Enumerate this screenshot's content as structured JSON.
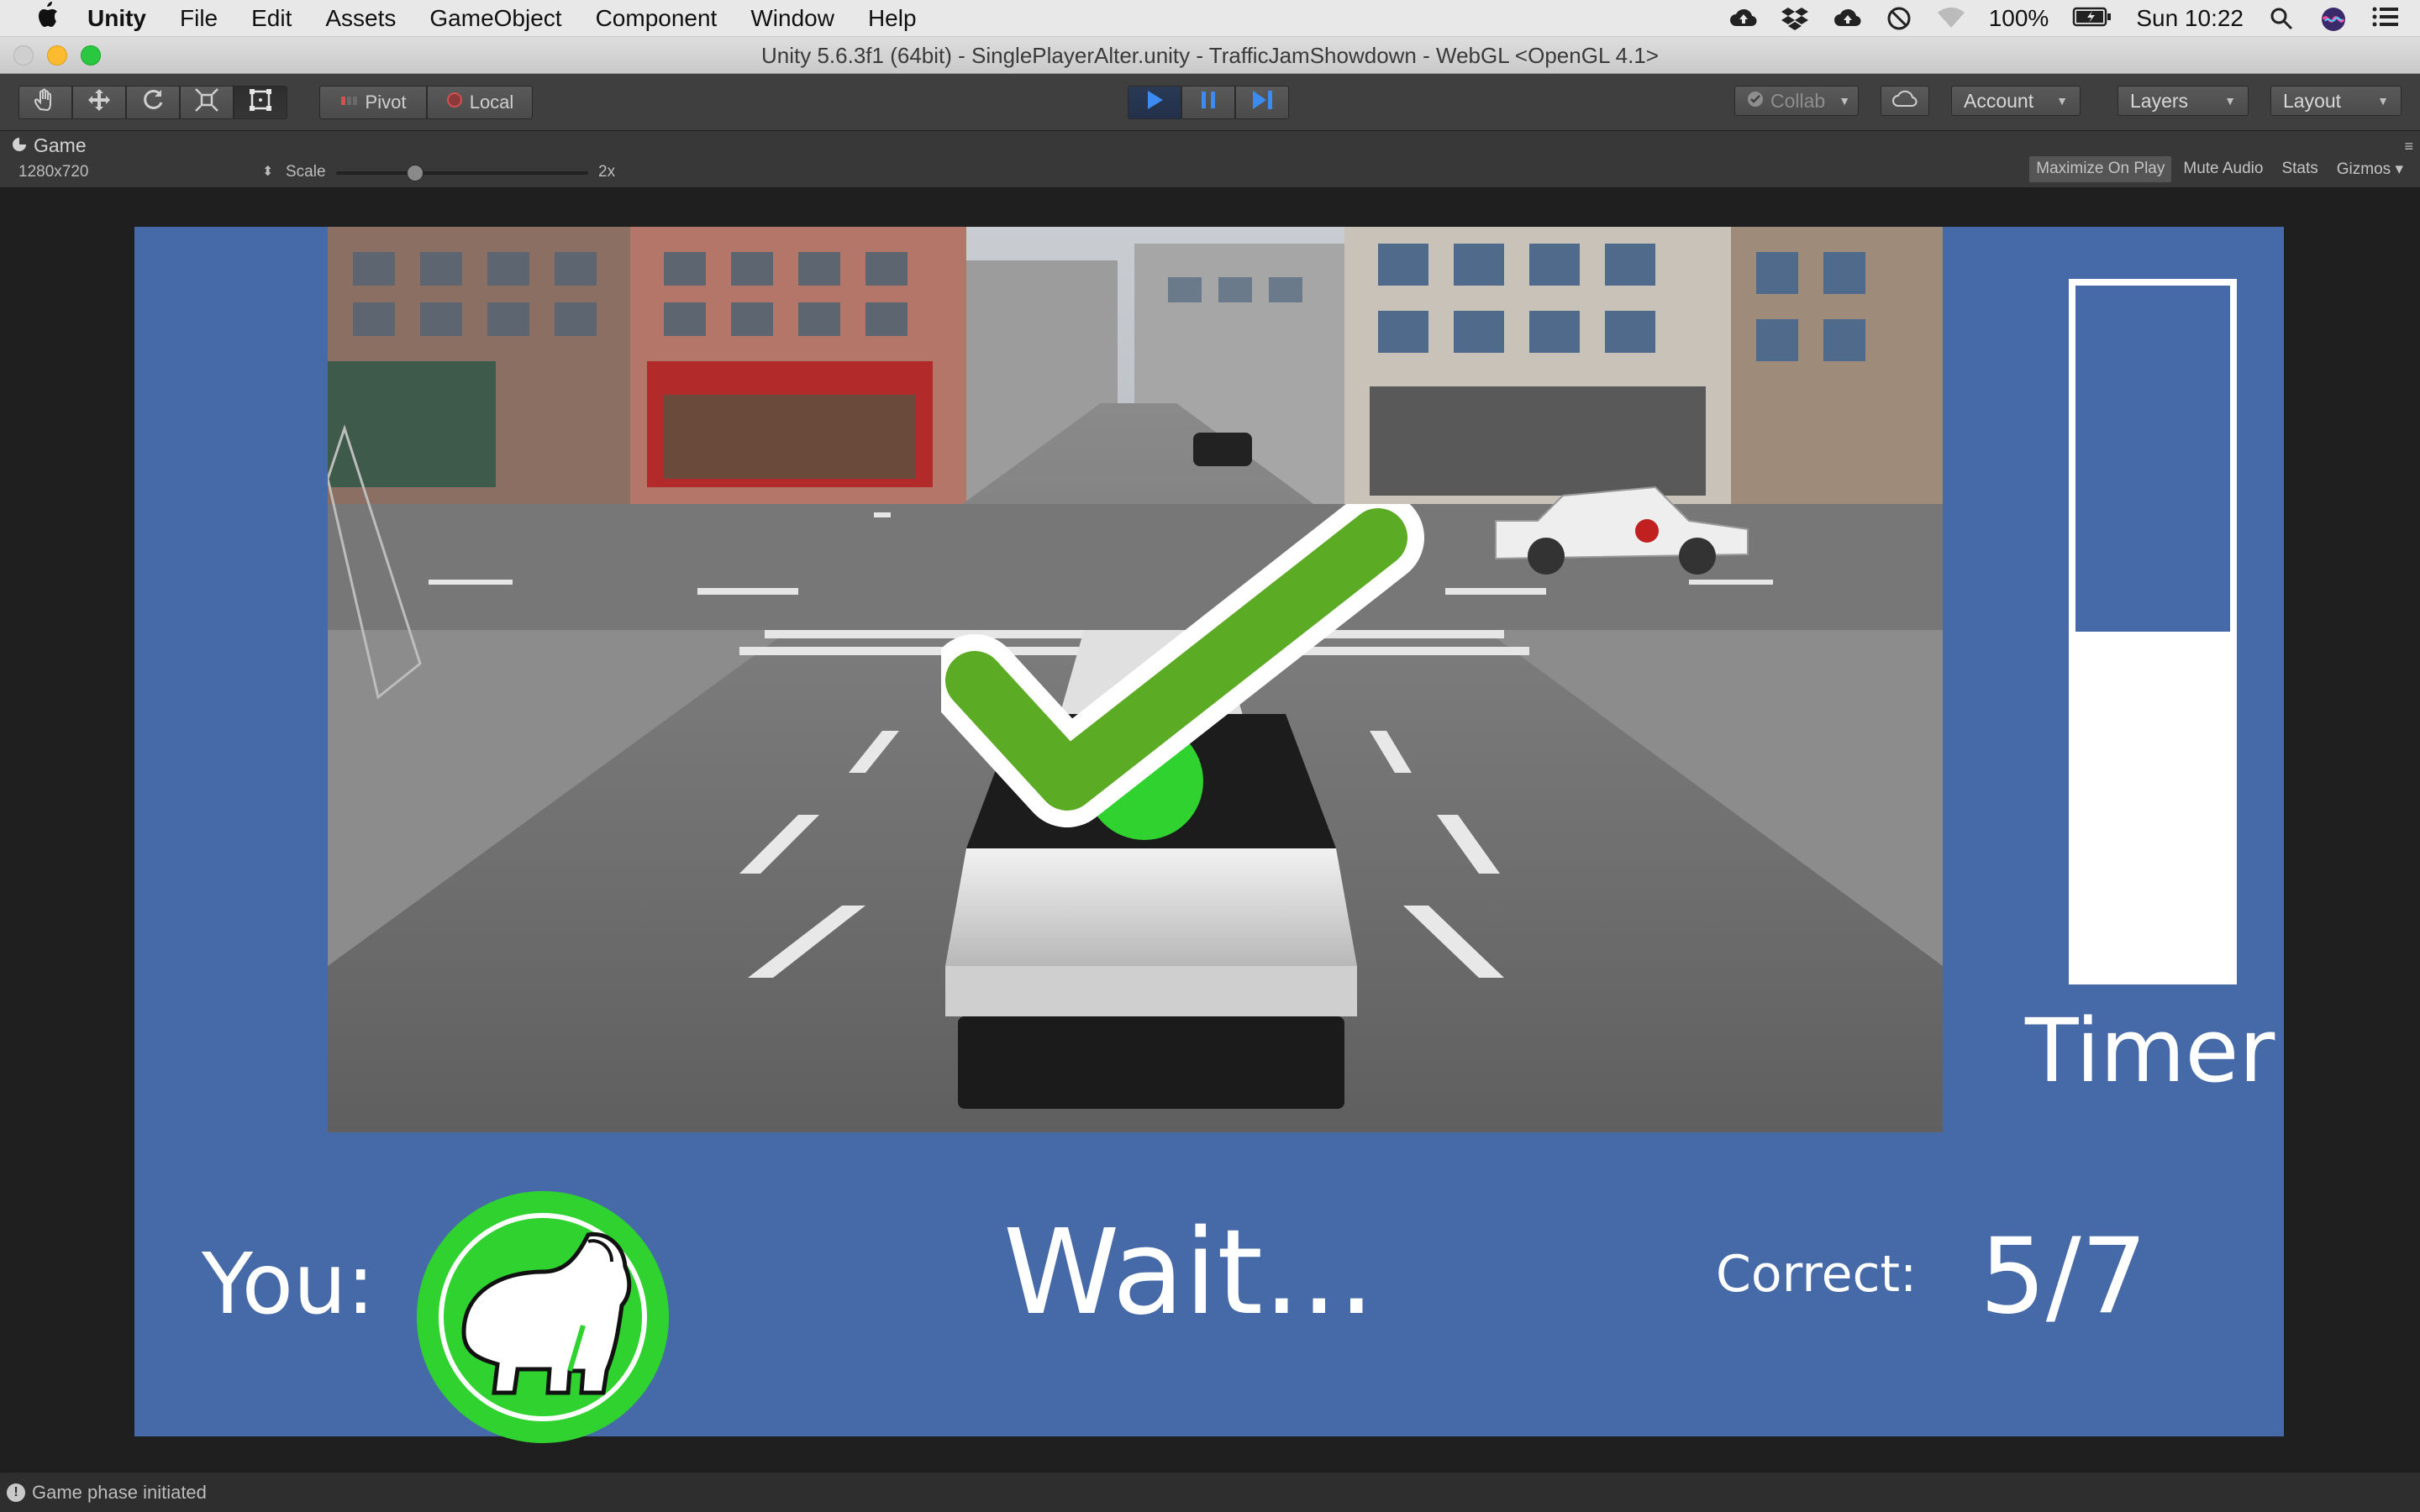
{
  "menubar": {
    "apple_icon": "apple-logo",
    "app_name": "Unity",
    "items": [
      "File",
      "Edit",
      "Assets",
      "GameObject",
      "Component",
      "Window",
      "Help"
    ],
    "battery": "100%",
    "clock": "Sun 10:22"
  },
  "window": {
    "title": "Unity 5.6.3f1 (64bit) - SinglePlayerAlter.unity - TrafficJamShowdown - WebGL <OpenGL 4.1>"
  },
  "toolbar": {
    "pivot_label": "Pivot",
    "local_label": "Local",
    "collab_label": "Collab",
    "account_label": "Account",
    "layers_label": "Layers",
    "layout_label": "Layout"
  },
  "game_view": {
    "tab_label": "Game",
    "resolution": "1280x720",
    "scale_label": "Scale",
    "scale_value": "2x",
    "maximize_label": "Maximize On Play",
    "mute_label": "Mute Audio",
    "stats_label": "Stats",
    "gizmos_label": "Gizmos"
  },
  "hud": {
    "timer_label": "Timer",
    "timer_remaining_fraction": 0.5,
    "you_label": "You:",
    "status_text": "Wait...",
    "correct_label": "Correct:",
    "correct_value": "5/7",
    "player_icon": "gorilla-icon",
    "result_icon": "checkmark-icon"
  },
  "colors": {
    "panel_blue": "#466aa8",
    "player_green": "#2fd22f",
    "check_green": "#5bab25",
    "play_blue": "#3b8bf0"
  },
  "status": {
    "message": "Game phase initiated"
  }
}
